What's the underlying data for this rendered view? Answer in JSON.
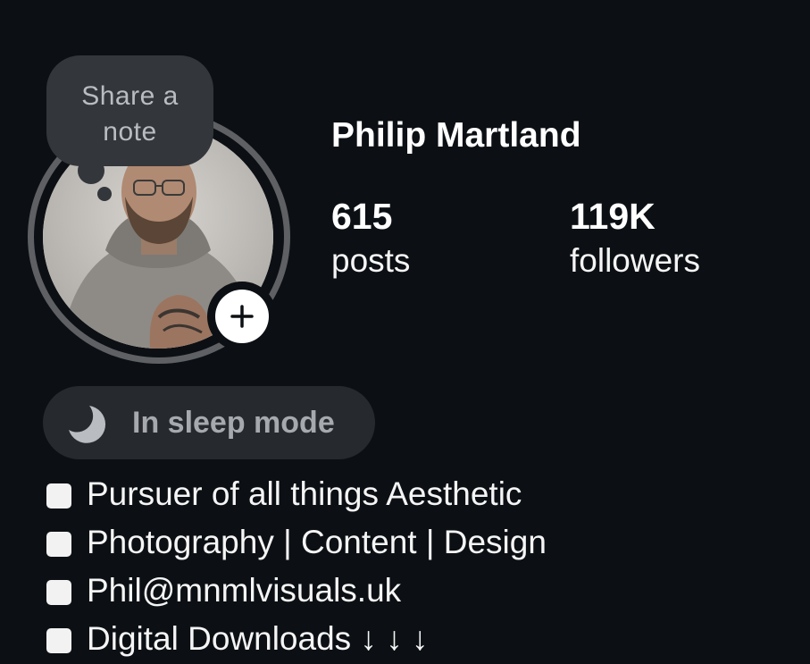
{
  "profile": {
    "name": "Philip Martland",
    "avatar_icon": "profile-photo",
    "add_icon": "plus-icon"
  },
  "note": {
    "line1": "Share a",
    "line2": "note"
  },
  "stats": [
    {
      "count": "615",
      "label": "posts"
    },
    {
      "count": "119K",
      "label": "followers"
    }
  ],
  "status": {
    "label": "In sleep mode",
    "icon": "moon-icon"
  },
  "bio": {
    "lines": [
      "Pursuer of all things Aesthetic",
      "Photography | Content | Design",
      "Phil@mnmlvisuals.uk",
      "Digital Downloads ↓ ↓ ↓"
    ],
    "bullet_icon": "white-square-icon"
  },
  "colors": {
    "background": "#0c1014",
    "bubble": "#33363b",
    "pill": "#26292e",
    "ring": "#5e6064",
    "muted_text": "#a6a9ae"
  }
}
